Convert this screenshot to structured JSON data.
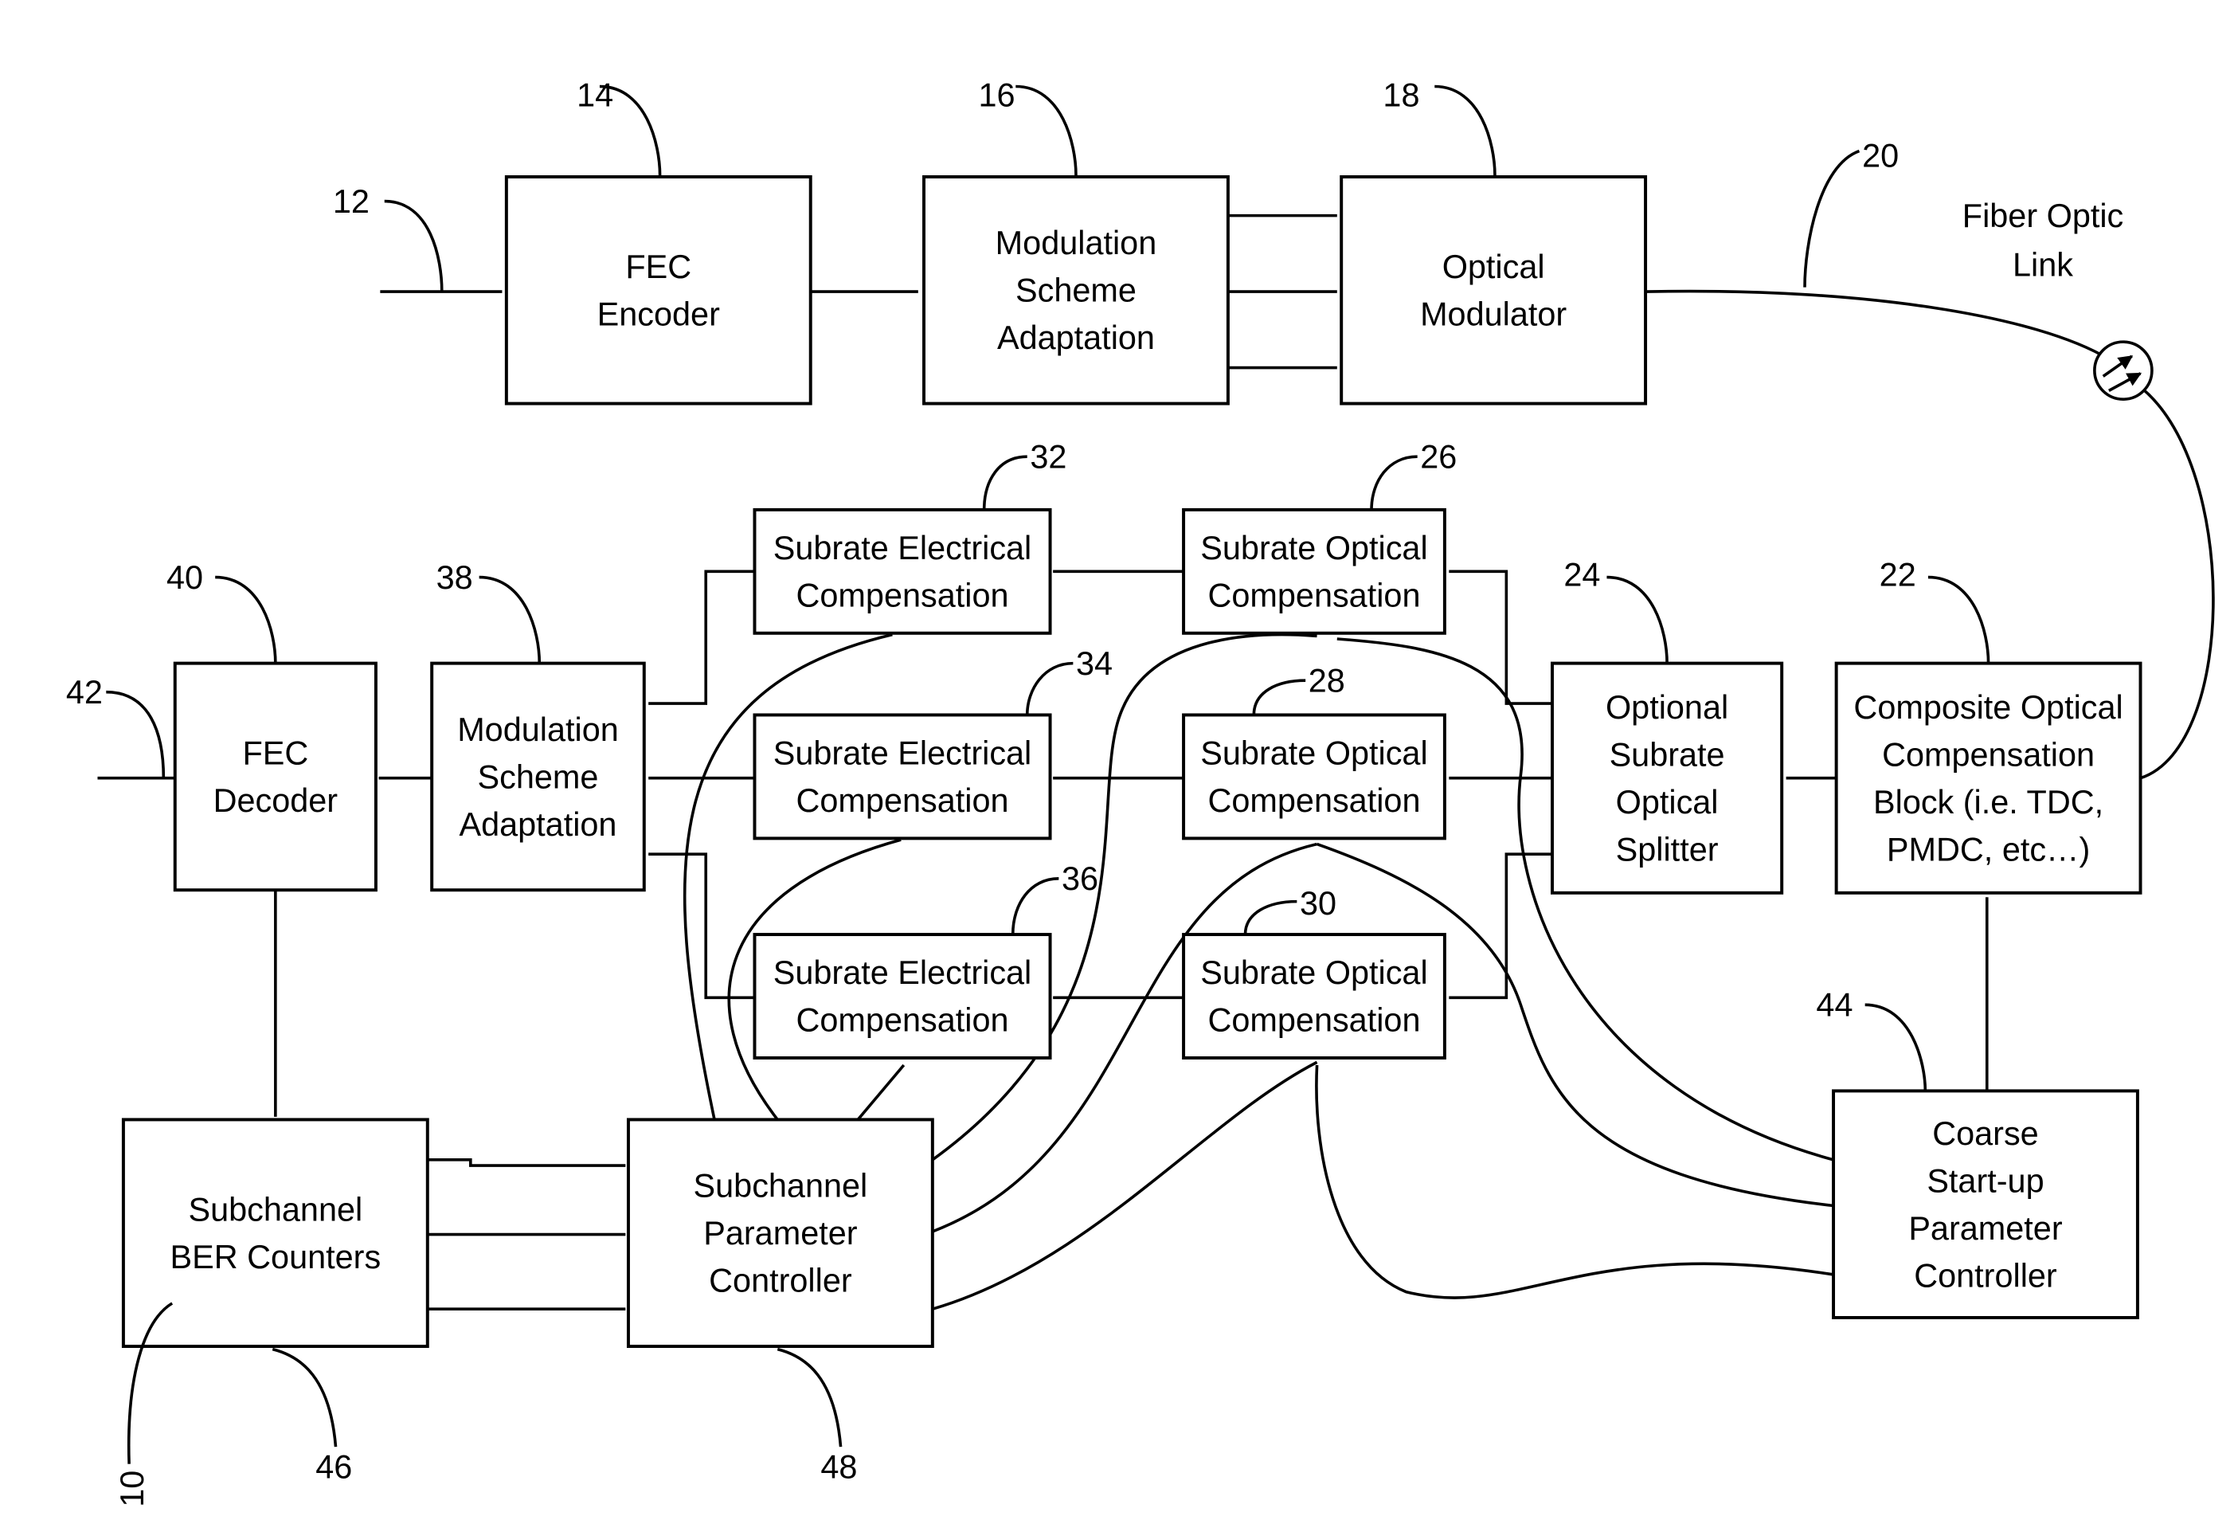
{
  "figure": {
    "blocks": [
      {
        "id": "fec-encoder",
        "ref": "14",
        "lines": [
          "FEC",
          "Encoder"
        ]
      },
      {
        "id": "mod-adapt-tx",
        "ref": "16",
        "lines": [
          "Modulation",
          "Scheme",
          "Adaptation"
        ]
      },
      {
        "id": "optical-modulator",
        "ref": "18",
        "lines": [
          "Optical",
          "Modulator"
        ]
      },
      {
        "id": "composite-comp",
        "ref": "22",
        "lines": [
          "Composite Optical",
          "Compensation",
          "Block (i.e. TDC,",
          "PMDC, etc…)"
        ]
      },
      {
        "id": "splitter",
        "ref": "24",
        "lines": [
          "Optional",
          "Subrate",
          "Optical",
          "Splitter"
        ]
      },
      {
        "id": "opt-comp-1",
        "ref": "26",
        "lines": [
          "Subrate Optical",
          "Compensation"
        ]
      },
      {
        "id": "opt-comp-2",
        "ref": "28",
        "lines": [
          "Subrate Optical",
          "Compensation"
        ]
      },
      {
        "id": "opt-comp-3",
        "ref": "30",
        "lines": [
          "Subrate Optical",
          "Compensation"
        ]
      },
      {
        "id": "elec-comp-1",
        "ref": "32",
        "lines": [
          "Subrate Electrical",
          "Compensation"
        ]
      },
      {
        "id": "elec-comp-2",
        "ref": "34",
        "lines": [
          "Subrate Electrical",
          "Compensation"
        ]
      },
      {
        "id": "elec-comp-3",
        "ref": "36",
        "lines": [
          "Subrate Electrical",
          "Compensation"
        ]
      },
      {
        "id": "mod-adapt-rx",
        "ref": "38",
        "lines": [
          "Modulation",
          "Scheme",
          "Adaptation"
        ]
      },
      {
        "id": "fec-decoder",
        "ref": "40",
        "lines": [
          "FEC",
          "Decoder"
        ]
      },
      {
        "id": "coarse-controller",
        "ref": "44",
        "lines": [
          "Coarse",
          "Start-up",
          "Parameter",
          "Controller"
        ]
      },
      {
        "id": "ber-counters",
        "ref": "46",
        "lines": [
          "Subchannel",
          "BER Counters"
        ]
      },
      {
        "id": "param-controller",
        "ref": "48",
        "lines": [
          "Subchannel",
          "Parameter",
          "Controller"
        ]
      }
    ],
    "refs": {
      "input": "12",
      "fiber": "20",
      "output": "42",
      "system": "10"
    },
    "fiber_label": [
      "Fiber Optic",
      "Link"
    ]
  }
}
